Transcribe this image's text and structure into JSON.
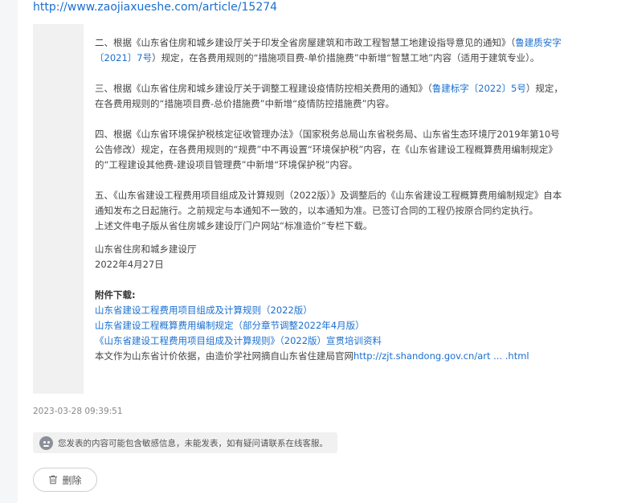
{
  "top_link": "http://www.zaojiaxueshe.com/article/15274",
  "article": {
    "p2_before": "二、根据《山东省住房和城乡建设厅关于印发全省房屋建筑和市政工程智慧工地建设指导意见的通知》（",
    "p2_link": "鲁建质安字〔2021〕7号",
    "p2_after": "）规定，在各费用规则的“措施项目费-单价措施费”中新增“智慧工地”内容（适用于建筑专业）。",
    "p3_before": "三、根据《山东省住房和城乡建设厅关于调整工程建设疫情防控相关费用的通知》（",
    "p3_link": "鲁建标字〔2022〕5号",
    "p3_after": "）规定，在各费用规则的“措施项目费-总价措施费”中新增“疫情防控措施费”内容。",
    "p4": "四、根据《山东省环境保护税核定征收管理办法》（国家税务总局山东省税务局、山东省生态环境厅2019年第10号公告修改）规定，在各费用规则的“规费”中不再设置“环境保护税”内容，在《山东省建设工程概算费用编制规定》的“工程建设其他费-建设项目管理费”中新增“环境保护税”内容。",
    "p5a": "五、《山东省建设工程费用项目组成及计算规则（2022版）》及调整后的《山东省建设工程概算费用编制规定》自本通知发布之日起施行。之前规定与本通知不一致的，以本通知为准。已签订合同的工程仍按原合同约定执行。",
    "p5b": "上述文件电子版从省住房城乡建设厅门户网站“标准造价”专栏下载。",
    "sig_org": "山东省住房和城乡建设厅",
    "sig_date": "2022年4月27日",
    "attach_title": "附件下载:",
    "attachments": [
      "山东省建设工程费用项目组成及计算规则（2022版）",
      "山东省建设工程概算费用编制规定（部分章节调整2022年4月版）",
      "《山东省建设工程费用项目组成及计算规则》（2022版）宣贯培训资料"
    ],
    "source_text": "本文作为山东省计价依据，由造价学社网摘自山东省住建局官网",
    "source_link": "http://zjt.shandong.gov.cn/art ... .html"
  },
  "timestamp": "2023-03-28 09:39:51",
  "notice": {
    "icon": "sad-face-icon",
    "text": "您发表的内容可能包含敏感信息，未能发表，如有疑问请联系在线客服。"
  },
  "delete_button": {
    "icon": "trash-icon",
    "label": "删除"
  }
}
